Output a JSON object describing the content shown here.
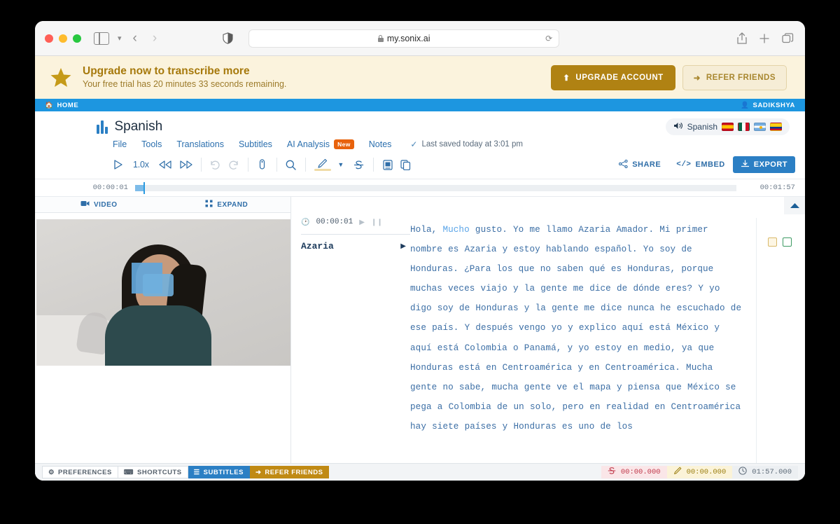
{
  "browser": {
    "url": "my.sonix.ai",
    "lock_icon": "lock-icon",
    "reload_icon": "reload-icon",
    "shield_icon": "privacy-shield-icon",
    "back_icon": "chevron-left-icon",
    "forward_icon": "chevron-right-icon",
    "sidebar_icon": "sidebar-toggle-icon",
    "sidebar_chevron": "chevron-down-icon",
    "share_icon": "share-icon",
    "new_tab_icon": "plus-icon",
    "tabs_icon": "tab-overview-icon"
  },
  "banner": {
    "star_icon": "star-icon",
    "title": "Upgrade now to transcribe more",
    "subtitle": "Your free trial has 20 minutes 33 seconds remaining.",
    "upgrade_label": "UPGRADE ACCOUNT",
    "upgrade_icon": "arrow-up-icon",
    "refer_label": "REFER FRIENDS",
    "refer_icon": "share-arrow-icon",
    "accent_color": "#b08213",
    "background_color": "#fbf3dd"
  },
  "navbar": {
    "home_label": "HOME",
    "home_icon": "home-icon",
    "user_label": "SADIKSHYA",
    "user_icon": "person-icon",
    "background_color": "#1d96e0"
  },
  "header": {
    "logo_icon": "sonix-waveform-logo",
    "title": "Spanish",
    "menu": [
      {
        "label": "File"
      },
      {
        "label": "Tools"
      },
      {
        "label": "Translations"
      },
      {
        "label": "Subtitles"
      },
      {
        "label": "AI Analysis",
        "badge": "New"
      },
      {
        "label": "Notes"
      }
    ],
    "saved_status": "Last saved today at 3:01 pm",
    "saved_icon": "check-icon",
    "language": {
      "speaker_icon": "speaker-icon",
      "label": "Spanish",
      "flags": [
        "spain-flag",
        "mexico-flag",
        "argentina-flag",
        "colombia-flag"
      ]
    }
  },
  "toolbar": {
    "play_icon": "play-icon",
    "speed_label": "1.0x",
    "rewind_icon": "rewind-icon",
    "forward_icon": "fast-forward-icon",
    "undo_icon": "undo-icon",
    "redo_icon": "redo-icon",
    "mic_icon": "microphone-icon",
    "search_icon": "search-icon",
    "highlighter_icon": "highlighter-icon",
    "highlighter_chevron": "chevron-down-icon",
    "strikethrough_icon": "strikethrough-icon",
    "dictionary_icon": "dictionary-icon",
    "copy_icon": "copy-icon",
    "share_label": "SHARE",
    "share_icon": "share-nodes-icon",
    "embed_label": "EMBED",
    "embed_icon": "code-icon",
    "export_label": "EXPORT",
    "export_icon": "download-icon",
    "export_color": "#2b7fc4"
  },
  "timeline": {
    "start_time": "00:00:01",
    "end_time": "00:01:57",
    "progress_percent": 1.3
  },
  "left_panel": {
    "tabs": [
      {
        "label": "VIDEO",
        "icon": "video-camera-icon"
      },
      {
        "label": "EXPAND",
        "icon": "expand-icon"
      }
    ]
  },
  "transcript": {
    "collapse_icon": "chevron-up-icon",
    "timestamp": "00:00:01",
    "clock_icon": "clock-icon",
    "play_icon": "play-icon",
    "pause_icon": "pause-icon",
    "speaker": "Azaria",
    "speaker_caret_icon": "caret-right-icon",
    "highlighted_word": "Mucho",
    "text_before": "Hola, ",
    "text_after": " gusto. Yo me llamo Azaria Amador. Mi primer nombre es Azaria y estoy hablando español. Yo soy de Honduras. ¿Para los que no saben qué es Honduras, porque muchas veces viajo y la gente me dice de dónde eres? Y yo digo soy de Honduras y la gente me dice nunca he escuchado de ese país. Y después vengo yo y explico aquí está México y aquí está Colombia o Panamá, y yo estoy en medio, ya que Honduras está en Centroamérica y en Centroamérica. Mucha gente no sabe, mucha gente ve el mapa y piensa que México se pega a Colombia de un solo, pero en realidad en Centroamérica hay siete países y Honduras es uno de los",
    "notes": [
      {
        "name": "note-swatch-yellow",
        "color": "#d9b96a"
      },
      {
        "name": "note-swatch-green",
        "color": "#3d9a63"
      }
    ]
  },
  "bottombar": {
    "buttons": [
      {
        "label": "PREFERENCES",
        "icon": "gear-icon",
        "style": "default"
      },
      {
        "label": "SHORTCUTS",
        "icon": "keyboard-icon",
        "style": "default"
      },
      {
        "label": "SUBTITLES",
        "icon": "lines-icon",
        "style": "blue"
      },
      {
        "label": "REFER FRIENDS",
        "icon": "share-arrow-icon",
        "style": "gold"
      }
    ],
    "stats": [
      {
        "icon": "strikethrough-icon",
        "value": "00:00.000",
        "style": "red"
      },
      {
        "icon": "highlighter-icon",
        "value": "00:00.000",
        "style": "yellow"
      },
      {
        "icon": "clock-icon",
        "value": "01:57.000",
        "style": "gray"
      }
    ]
  }
}
